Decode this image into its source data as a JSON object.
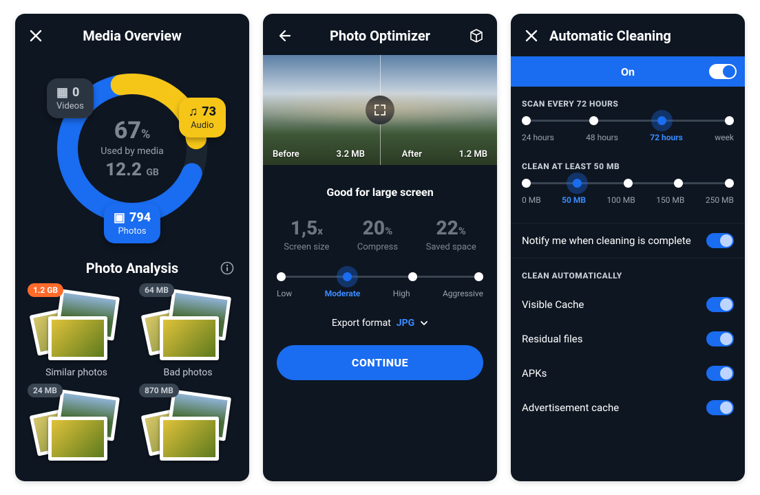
{
  "screen1": {
    "title": "Media Overview",
    "center": {
      "pct": "67",
      "pct_unit": "%",
      "label": "Used by media",
      "size": "12.2",
      "size_unit": "GB"
    },
    "chips": {
      "videos": {
        "count": "0",
        "label": "Videos"
      },
      "audio": {
        "count": "73",
        "label": "Audio"
      },
      "photos": {
        "count": "794",
        "label": "Photos"
      }
    },
    "analysis_title": "Photo Analysis",
    "cards": [
      {
        "badge": "1.2 GB",
        "badge_color": "orange",
        "label": "Similar photos"
      },
      {
        "badge": "64 MB",
        "badge_color": "grey",
        "label": "Bad photos"
      },
      {
        "badge": "24 MB",
        "badge_color": "grey",
        "label": ""
      },
      {
        "badge": "870 MB",
        "badge_color": "grey",
        "label": ""
      }
    ]
  },
  "screen2": {
    "title": "Photo Optimizer",
    "before_label": "Before",
    "before_size": "3.2 MB",
    "after_label": "After",
    "after_size": "1.2 MB",
    "headline": "Good for large screen",
    "stats": [
      {
        "value": "1,5",
        "unit": "x",
        "label": "Screen size"
      },
      {
        "value": "20",
        "unit": "%",
        "label": "Compress"
      },
      {
        "value": "22",
        "unit": "%",
        "label": "Saved space"
      }
    ],
    "levels": [
      "Low",
      "Moderate",
      "High",
      "Aggressive"
    ],
    "level_selected": 1,
    "export_label": "Export format",
    "export_value": "JPG",
    "cta": "CONTINUE"
  },
  "screen3": {
    "title": "Automatic Cleaning",
    "on_label": "On",
    "scan_label": "SCAN EVERY 72 HOURS",
    "scan_options": [
      "24 hours",
      "48 hours",
      "72 hours",
      "week"
    ],
    "scan_selected": 2,
    "clean_label": "CLEAN AT LEAST 50 MB",
    "clean_options": [
      "0 MB",
      "50 MB",
      "100 MB",
      "150 MB",
      "250 MB"
    ],
    "clean_selected": 1,
    "notify": "Notify me when cleaning is complete",
    "auto_label": "CLEAN AUTOMATICALLY",
    "auto_items": [
      "Visible Cache",
      "Residual files",
      "APKs",
      "Advertisement cache"
    ]
  },
  "chart_data": {
    "type": "pie",
    "title": "Media Overview",
    "series": [
      {
        "name": "Photos",
        "value": 794,
        "color": "#1a6cf0"
      },
      {
        "name": "Audio",
        "value": 73,
        "color": "#f5c518"
      },
      {
        "name": "Videos",
        "value": 0,
        "color": "#2b3541"
      }
    ],
    "center_label": "67% Used by media — 12.2 GB"
  }
}
